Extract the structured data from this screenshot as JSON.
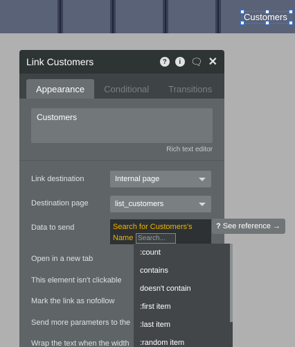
{
  "canvas": {
    "selected_element_label": "Customers"
  },
  "panel": {
    "title": "Link Customers",
    "icons": [
      "help-icon",
      "info-icon",
      "comment-icon",
      "close-icon"
    ],
    "tabs": [
      {
        "label": "Appearance",
        "active": true
      },
      {
        "label": "Conditional",
        "active": false
      },
      {
        "label": "Transitions",
        "active": false
      }
    ],
    "text_value": "Customers",
    "rich_text_editor_label": "Rich text editor",
    "fields": {
      "link_destination_label": "Link destination",
      "link_destination_value": "Internal page",
      "destination_page_label": "Destination page",
      "destination_page_value": "list_customers",
      "data_to_send_label": "Data to send",
      "data_to_send_value": "Search for Customers's Name",
      "open_new_tab_label": "Open in a new tab",
      "not_clickable_label": "This element isn't clickable",
      "nofollow_label": "Mark the link as nofollow",
      "send_params_label": "Send more parameters to the",
      "wrap_text_label": "Wrap the text when the width"
    }
  },
  "autocomplete": {
    "placeholder": "Search...",
    "see_reference": "See reference →",
    "items": [
      ":count",
      "contains",
      "doesn't contain",
      ":first item",
      ":last item",
      ":random item"
    ]
  },
  "colors": {
    "accent": "#2d7be5",
    "expression_text": "#f0b400",
    "panel_bg": "#5f6466",
    "header_bg": "#2e3334"
  }
}
